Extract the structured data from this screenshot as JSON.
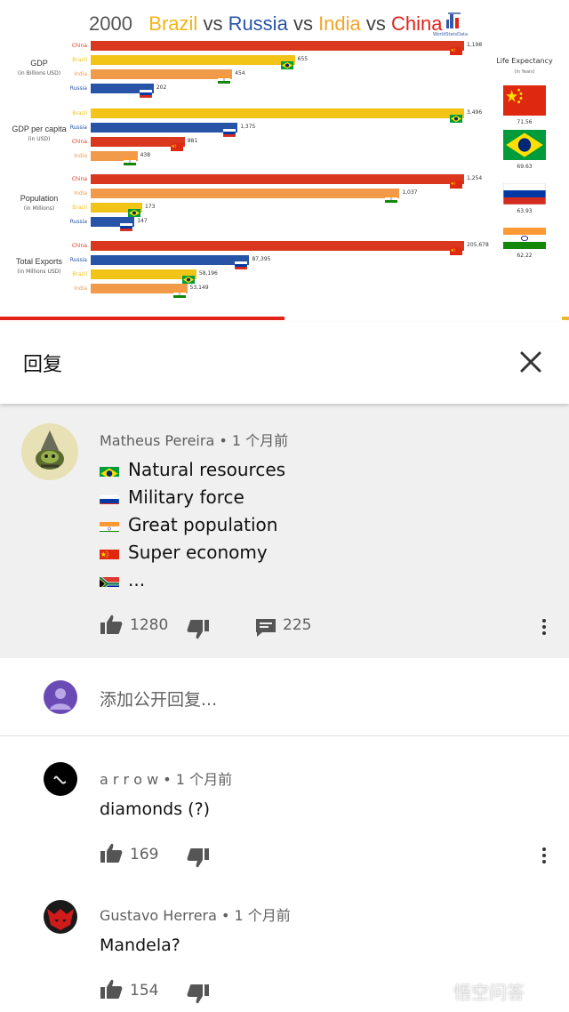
{
  "video": {
    "title": {
      "year": "2000",
      "c1": "Brazil",
      "vs1": "vs",
      "c2": "Russia",
      "vs2": "vs",
      "c3": "India",
      "vs3": "vs",
      "c4": "China"
    },
    "logo_text": "WorldStatsData",
    "sections": [
      {
        "label": "GDP",
        "unit": "(in Billions USD)",
        "rows": [
          {
            "country": "China",
            "value": "1,198",
            "color": "#d9381e"
          },
          {
            "country": "Brazil",
            "value": "655",
            "color": "#f2c418"
          },
          {
            "country": "India",
            "value": "454",
            "color": "#f09a4a"
          },
          {
            "country": "Russia",
            "value": "202",
            "color": "#2854a8"
          }
        ]
      },
      {
        "label": "GDP per capita",
        "unit": "(in USD)",
        "rows": [
          {
            "country": "Brazil",
            "value": "3,496",
            "color": "#f2c418"
          },
          {
            "country": "Russia",
            "value": "1,375",
            "color": "#2854a8"
          },
          {
            "country": "China",
            "value": "881",
            "color": "#d9381e"
          },
          {
            "country": "India",
            "value": "438",
            "color": "#f09a4a"
          }
        ]
      },
      {
        "label": "Population",
        "unit": "(in Millions)",
        "rows": [
          {
            "country": "China",
            "value": "1,254",
            "color": "#d9381e"
          },
          {
            "country": "India",
            "value": "1,037",
            "color": "#f09a4a"
          },
          {
            "country": "Brazil",
            "value": "173",
            "color": "#f2c418"
          },
          {
            "country": "Russia",
            "value": "147",
            "color": "#2854a8"
          }
        ]
      },
      {
        "label": "Total Exports",
        "unit": "(in Millions USD)",
        "rows": [
          {
            "country": "China",
            "value": "205,678",
            "color": "#d9381e"
          },
          {
            "country": "Russia",
            "value": "87,395",
            "color": "#2854a8"
          },
          {
            "country": "Brazil",
            "value": "58,196",
            "color": "#f2c418"
          },
          {
            "country": "India",
            "value": "53,149",
            "color": "#f09a4a"
          }
        ]
      }
    ],
    "life_expectancy": {
      "title": "Life Expectancy",
      "unit": "(in Years)",
      "items": [
        {
          "country": "China",
          "value": "71.56"
        },
        {
          "country": "Brazil",
          "value": "69.63"
        },
        {
          "country": "Russia",
          "value": "63.93"
        },
        {
          "country": "India",
          "value": "62.22"
        }
      ]
    },
    "progress": 0.5
  },
  "reply_header": {
    "title": "回复",
    "close_icon": "close-icon"
  },
  "top_comment": {
    "author": "Matheus Pereira",
    "time": " • 1 个月前",
    "lines": [
      {
        "flag": "brazil",
        "text": "Natural resources"
      },
      {
        "flag": "russia",
        "text": "Military force"
      },
      {
        "flag": "india",
        "text": "Great population"
      },
      {
        "flag": "china",
        "text": "Super economy"
      },
      {
        "flag": "south-africa",
        "text": "..."
      }
    ],
    "likes": "1280",
    "replies": "225"
  },
  "add_reply": {
    "placeholder": "添加公开回复..."
  },
  "replies": [
    {
      "author": "a r r o w",
      "time": " • 1 个月前",
      "text": "diamonds (?)",
      "likes": "169"
    },
    {
      "author": "Gustavo Herrera",
      "time": " • 1 个月前",
      "text": "Mandela?",
      "likes": "154"
    }
  ],
  "watermark": "悟空问答"
}
